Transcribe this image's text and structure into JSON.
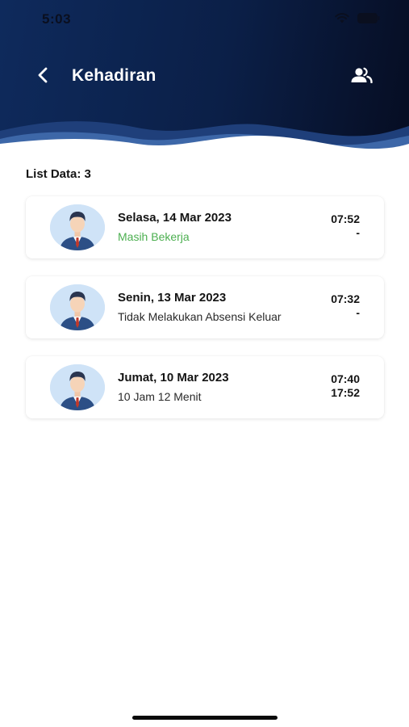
{
  "status_bar": {
    "time": "5:03",
    "icons": [
      "wifi-icon",
      "battery-icon"
    ]
  },
  "header": {
    "title": "Kehadiran",
    "back_icon": "chevron-left-icon",
    "action_icon": "people-icon"
  },
  "list": {
    "count_label": "List Data: 3",
    "items": [
      {
        "date": "Selasa, 14 Mar 2023",
        "status": "Masih Bekerja",
        "status_color": "#4caf50",
        "time_in": "07:52",
        "time_out": "-"
      },
      {
        "date": "Senin, 13 Mar 2023",
        "status": "Tidak Melakukan Absensi Keluar",
        "status_color": "#2a2a2a",
        "time_in": "07:32",
        "time_out": "-"
      },
      {
        "date": "Jumat, 10 Mar 2023",
        "status": "10 Jam 12 Menit",
        "status_color": "#2a2a2a",
        "time_in": "07:40",
        "time_out": "17:52"
      }
    ]
  },
  "colors": {
    "header_dark": "#0b1f47",
    "wave_light": "#3d67a8",
    "accent_green": "#4caf50"
  }
}
